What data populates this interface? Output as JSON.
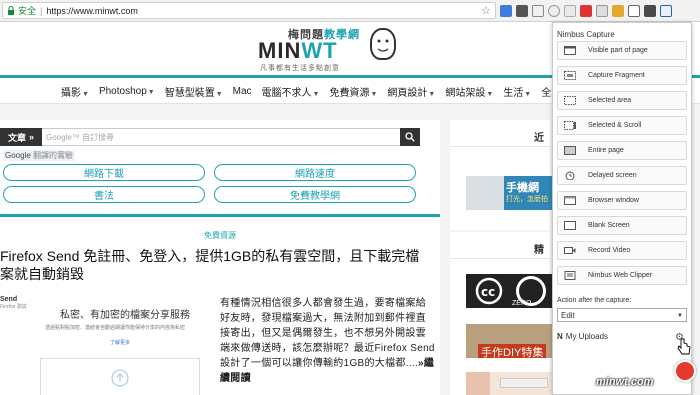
{
  "browser": {
    "secure_label": "安全",
    "separator": "|",
    "url": "https://www.minwt.com"
  },
  "logo": {
    "chinese": "梅問題教學網",
    "chinese_plain": "梅問題",
    "chinese_accent": "教學網",
    "main_a": "MIN",
    "main_b": "WT",
    "tagline": "凡事都有生活多點創意"
  },
  "nav": [
    {
      "label": "攝影",
      "has_menu": true
    },
    {
      "label": "Photoshop",
      "has_menu": true
    },
    {
      "label": "智慧型裝置",
      "has_menu": true
    },
    {
      "label": "Mac",
      "has_menu": false
    },
    {
      "label": "電腦不求人",
      "has_menu": true
    },
    {
      "label": "免費資源",
      "has_menu": true
    },
    {
      "label": "網頁設計",
      "has_menu": true
    },
    {
      "label": "網站架設",
      "has_menu": true
    },
    {
      "label": "生活",
      "has_menu": true
    },
    {
      "label": "全站導覽",
      "has_menu": false
    }
  ],
  "search": {
    "label": "文章",
    "label_arrow": "»",
    "placeholder": "Google™ 自訂搜尋",
    "google_note_brand": "Google",
    "google_note_text": "翻譯的實驗"
  },
  "quick_links": [
    "網路下載",
    "網路速度",
    "書法",
    "免費教學網"
  ],
  "post": {
    "category": "免費資源",
    "title": "Firefox Send 免註冊、免登入，提供1GB的私有雲空間，且下載完檔案就自動銷毀",
    "excerpt": "有種情況相信很多人都會發生過，要寄檔案給好友時，發現檔案過大，無法附加到郵件裡直接寄出，但又是偶爾發生，也不想另外開設雲端來做傳送時，該怎麼辦呢？最近Firefox Send設計了一個可以讓你傳輸約1GB的大檔都....",
    "more": "»繼續閱讀",
    "thumb_brand": "Send",
    "thumb_brand_sub": "Firefox 測試",
    "thumb_heading": "私密、有加密的檔案分享服務",
    "thumb_desc": "透過點對點加密、連結會自動過期讓你能保持分享的內容為私密",
    "thumb_link": "了解更多"
  },
  "sidebar": {
    "card1_title": "近",
    "card2_title": "精",
    "ad_text": "手機網",
    "ad_sub": "打光，怎麼拍",
    "promo_text": "手作DIY特集",
    "promo_zero": "ZERO"
  },
  "nimbus": {
    "header": "Nimbus Capture",
    "items": [
      {
        "label": "Visible part of page",
        "icon": "page-icon"
      },
      {
        "label": "Capture Fragment",
        "icon": "fragment-icon"
      },
      {
        "label": "Selected area",
        "icon": "area-icon"
      },
      {
        "label": "Selected & Scroll",
        "icon": "scroll-icon"
      },
      {
        "label": "Entire page",
        "icon": "full-page-icon"
      },
      {
        "label": "Delayed screen",
        "icon": "timer-icon"
      },
      {
        "label": "Browser window",
        "icon": "window-icon"
      },
      {
        "label": "Blank Screen",
        "icon": "blank-icon"
      },
      {
        "label": "Record Video",
        "icon": "video-icon"
      },
      {
        "label": "Nimbus Web Clipper",
        "icon": "clipper-icon"
      }
    ],
    "after_label": "Action after the capture:",
    "after_value": "Edit",
    "uploads_label": "My Uploads"
  },
  "watermark": "minwt.com"
}
